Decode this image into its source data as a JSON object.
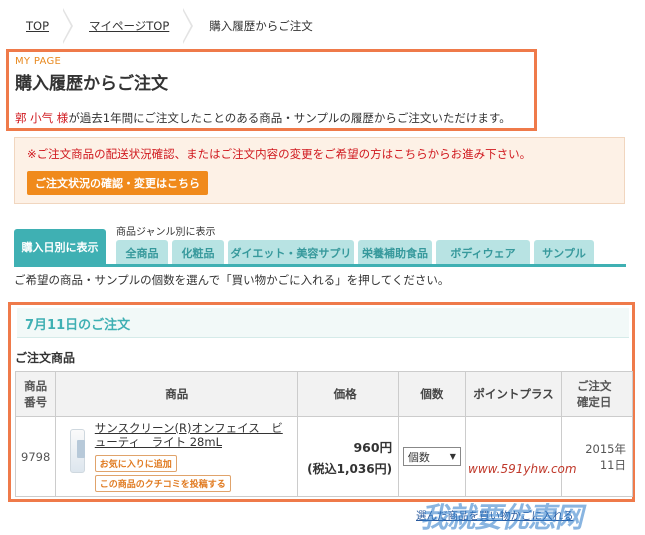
{
  "breadcrumb": {
    "top": "TOP",
    "mypage": "マイページTOP",
    "current": "購入履歴からご注文"
  },
  "header": {
    "mypage_label": "MY PAGE",
    "title": "購入履歴からご注文",
    "user_name": "郭 小气 様",
    "intro_rest": "が過去1年間にご注文したことのある商品・サンプルの履歴からご注文いただけます。"
  },
  "notice": {
    "text": "※ご注文商品の配送状況確認、またはご注文内容の変更をご希望の方はこちらからお進み下さい。",
    "button": "ご注文状況の確認・変更はこちら"
  },
  "tabs": {
    "main": "購入日別に表示",
    "genre_label": "商品ジャンル別に表示",
    "genres": [
      "全商品",
      "化粧品",
      "ダイエット・美容サプリ",
      "栄養補助食品",
      "ボディウェア",
      "サンプル"
    ]
  },
  "instruction": "ご希望の商品・サンプルの個数を選んで「買い物かごに入れる」を押してください。",
  "order": {
    "date_title": "7月11日のご注文",
    "section_title": "ご注文商品",
    "columns": {
      "no": "商品\n番号",
      "product": "商品",
      "price": "価格",
      "qty": "個数",
      "point": "ポイントプラス",
      "date": "ご注文\n確定日"
    },
    "items": [
      {
        "no": "9798",
        "name": "サンスクリーン(R)オンフェイス　ビューティ　ライト 28mL",
        "fav_button": "お気に入りに追加",
        "review_button": "この商品のクチコミを投稿する",
        "price": "960円",
        "price_tax": "(税込1,036円)",
        "qty": "個数",
        "date_year": "2015年",
        "date_day": "11日"
      }
    ]
  },
  "footer": {
    "text": "選んだ商品を買い物かごに入れる"
  },
  "watermark": {
    "url": "www.591yhw.com",
    "text": "我就要优惠网"
  },
  "colors": {
    "accent_orange": "#ef7a4a",
    "teal": "#3fb0b3",
    "red_text": "#d0181e"
  }
}
